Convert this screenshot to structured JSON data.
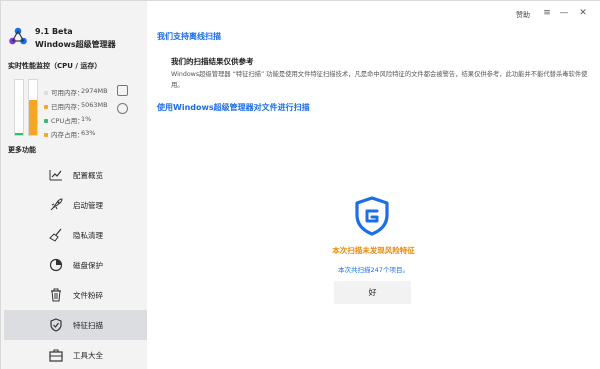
{
  "app": {
    "version": "9.1 Beta",
    "name": "Windows超级管理器"
  },
  "sidebar": {
    "perf_title": "实时性能监控（CPU / 运存）",
    "stats": [
      {
        "label": "可用内存：",
        "value": "2974MB",
        "color": "#dcdcdc"
      },
      {
        "label": "已用内存：",
        "value": "5063MB",
        "color": "#f5a623"
      },
      {
        "label": "CPU占用：",
        "value": "1%",
        "color": "#2fbf71"
      },
      {
        "label": "内存占用：",
        "value": "63%",
        "color": "#f5a623"
      }
    ],
    "meters": {
      "cpu_percent": 1,
      "memory_percent": 63,
      "cpu_color": "#2fbf71",
      "memory_color": "#f5a623"
    },
    "more_title": "更多功能",
    "items": [
      {
        "label": "配置概览",
        "icon": "chart-icon"
      },
      {
        "label": "启动管理",
        "icon": "rocket-icon"
      },
      {
        "label": "隐私清理",
        "icon": "broom-icon"
      },
      {
        "label": "磁盘保护",
        "icon": "disk-pie-icon"
      },
      {
        "label": "文件粉碎",
        "icon": "trash-icon"
      },
      {
        "label": "特征扫描",
        "icon": "shield-check-icon",
        "active": true
      },
      {
        "label": "工具大全",
        "icon": "toolbox-icon"
      }
    ]
  },
  "titlebar": {
    "sponsor": "赞助"
  },
  "main": {
    "offline_link": "我们支持离线扫描",
    "ref_title": "我们的扫描结果仅供参考",
    "ref_desc": "Windows超级管理器 “特征扫描” 功能是使用文件特征扫描技术，凡是命中风险特征的文件都会被警告，结果仅供参考，此功能并不能代替杀毒软件使用。",
    "scan_file_link": "使用Windows超级管理器对文件进行扫描",
    "result_title": "本次扫描未发现风险特征",
    "result_sub": "本次共扫描247个项目。",
    "ok_label": "好",
    "accent_color": "#1a6fe8",
    "warning_color": "#e8890c"
  }
}
